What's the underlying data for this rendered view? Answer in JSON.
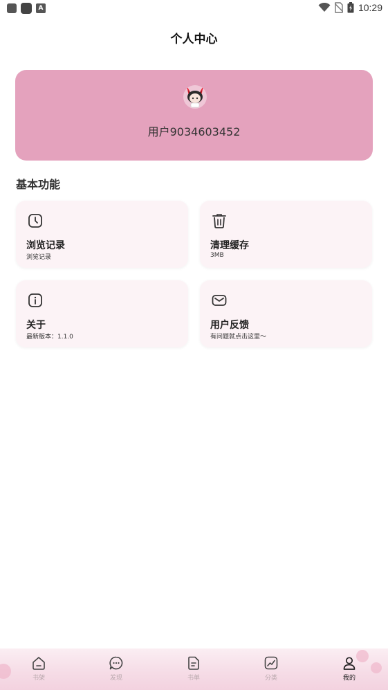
{
  "status_bar": {
    "time": "10:29",
    "left_badge": "A"
  },
  "header": {
    "title": "个人中心"
  },
  "profile": {
    "username": "用户9034603452"
  },
  "section": {
    "title": "基本功能"
  },
  "features": [
    {
      "icon": "clock-icon",
      "title": "浏览记录",
      "subtitle": "浏览记录"
    },
    {
      "icon": "trash-icon",
      "title": "清理缓存",
      "subtitle": "3MB"
    },
    {
      "icon": "info-icon",
      "title": "关于",
      "subtitle": "最新版本：1.1.0"
    },
    {
      "icon": "mail-icon",
      "title": "用户反馈",
      "subtitle": "有问题就点击这里～"
    }
  ],
  "nav": [
    {
      "icon": "home-icon",
      "label": "书架",
      "active": false
    },
    {
      "icon": "chat-icon",
      "label": "发现",
      "active": false
    },
    {
      "icon": "document-icon",
      "label": "书单",
      "active": false
    },
    {
      "icon": "chart-icon",
      "label": "分类",
      "active": false
    },
    {
      "icon": "user-icon",
      "label": "我的",
      "active": true
    }
  ],
  "colors": {
    "profile_bg": "#e4a2bd",
    "card_bg": "#fcf3f6",
    "nav_bg": "#f6dde7"
  }
}
